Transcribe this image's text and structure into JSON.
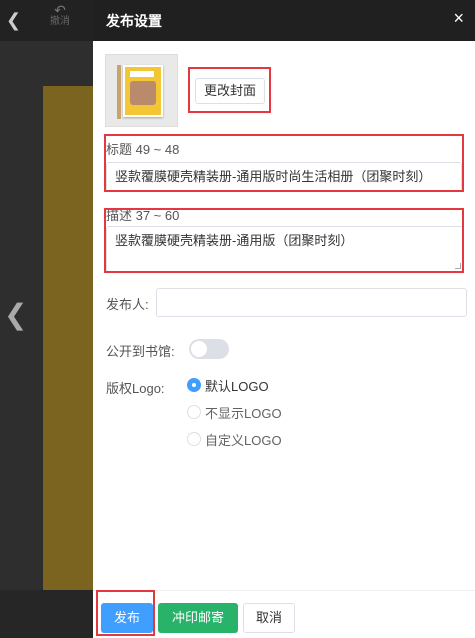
{
  "editor": {
    "back_icon": "chevron-left-icon",
    "undo_label": "撤消",
    "undo_icon": "undo-icon",
    "prev_icon": "chevron-left-icon"
  },
  "panel": {
    "title": "发布设置",
    "close_glyph": "×",
    "change_cover_label": "更改封面",
    "title_label": "标题 49 ~ 48",
    "title_value": "竖款覆膜硬壳精装册-通用版时尚生活相册（团聚时刻）",
    "desc_label": "描述 37 ~ 60",
    "desc_value": "竖款覆膜硬壳精装册-通用版（团聚时刻）",
    "publisher_label": "发布人:",
    "publisher_value": "",
    "public_label": "公开到书馆:",
    "public_on": false,
    "logo_label": "版权Logo:",
    "logo_options": [
      "默认LOGO",
      "不显示LOGO",
      "自定义LOGO"
    ],
    "logo_selected": "默认LOGO"
  },
  "footer": {
    "publish_label": "发布",
    "print_label": "冲印邮寄",
    "cancel_label": "取消"
  },
  "colors": {
    "primary": "#409eff",
    "success": "#29b36a",
    "highlight": "#e3383f",
    "page_bg": "#7b6420"
  }
}
